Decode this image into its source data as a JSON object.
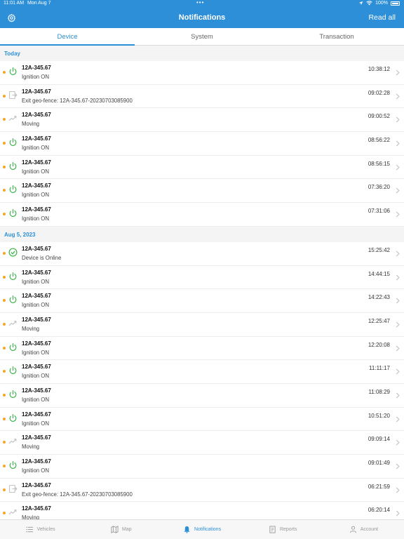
{
  "status_bar": {
    "time": "11:01 AM",
    "date": "Mon Aug 7",
    "battery": "100%"
  },
  "header": {
    "title": "Notifications",
    "read_all": "Read all"
  },
  "tabs": [
    {
      "label": "Device",
      "active": true
    },
    {
      "label": "System",
      "active": false
    },
    {
      "label": "Transaction",
      "active": false
    }
  ],
  "sections": [
    {
      "title": "Today",
      "items": [
        {
          "icon": "power-icon",
          "plate": "12A-345.67",
          "message": "Ignition ON",
          "time": "10:38:12"
        },
        {
          "icon": "exit-geofence-icon",
          "plate": "12A-345.67",
          "message": "Exit geo-fence: 12A-345.67-20230703085900",
          "time": "09:02:28"
        },
        {
          "icon": "moving-icon",
          "plate": "12A-345.67",
          "message": "Moving",
          "time": "09:00:52"
        },
        {
          "icon": "power-icon",
          "plate": "12A-345.67",
          "message": "Ignition ON",
          "time": "08:56:22"
        },
        {
          "icon": "power-icon",
          "plate": "12A-345.67",
          "message": "Ignition ON",
          "time": "08:56:15"
        },
        {
          "icon": "power-icon",
          "plate": "12A-345.67",
          "message": "Ignition ON",
          "time": "07:36:20"
        },
        {
          "icon": "power-icon",
          "plate": "12A-345.67",
          "message": "Ignition ON",
          "time": "07:31:06"
        }
      ]
    },
    {
      "title": "Aug 5, 2023",
      "items": [
        {
          "icon": "online-icon",
          "plate": "12A-345.67",
          "message": "Device is Online",
          "time": "15:25:42"
        },
        {
          "icon": "power-icon",
          "plate": "12A-345.67",
          "message": "Ignition ON",
          "time": "14:44:15"
        },
        {
          "icon": "power-icon",
          "plate": "12A-345.67",
          "message": "Ignition ON",
          "time": "14:22:43"
        },
        {
          "icon": "moving-icon",
          "plate": "12A-345.67",
          "message": "Moving",
          "time": "12:25:47"
        },
        {
          "icon": "power-icon",
          "plate": "12A-345.67",
          "message": "Ignition ON",
          "time": "12:20:08"
        },
        {
          "icon": "power-icon",
          "plate": "12A-345.67",
          "message": "Ignition ON",
          "time": "11:11:17"
        },
        {
          "icon": "power-icon",
          "plate": "12A-345.67",
          "message": "Ignition ON",
          "time": "11:08:29"
        },
        {
          "icon": "power-icon",
          "plate": "12A-345.67",
          "message": "Ignition ON",
          "time": "10:51:20"
        },
        {
          "icon": "moving-icon",
          "plate": "12A-345.67",
          "message": "Moving",
          "time": "09:09:14"
        },
        {
          "icon": "power-icon",
          "plate": "12A-345.67",
          "message": "Ignition ON",
          "time": "09:01:49"
        },
        {
          "icon": "exit-geofence-icon",
          "plate": "12A-345.67",
          "message": "Exit geo-fence: 12A-345.67-20230703085900",
          "time": "06:21:59"
        },
        {
          "icon": "moving-icon",
          "plate": "12A-345.67",
          "message": "Moving",
          "time": "06:20:14"
        }
      ]
    }
  ],
  "bottom_tabs": [
    {
      "label": "Vehicles",
      "icon": "list-icon",
      "active": false
    },
    {
      "label": "Map",
      "icon": "map-icon",
      "active": false
    },
    {
      "label": "Notifications",
      "icon": "bell-icon",
      "active": true
    },
    {
      "label": "Reports",
      "icon": "report-icon",
      "active": false
    },
    {
      "label": "Account",
      "icon": "person-icon",
      "active": false
    }
  ],
  "colors": {
    "accent": "#2d8fd8",
    "unread_dot": "#f5a623",
    "power": "#3bb34a",
    "muted_icon": "#b9b9b9"
  }
}
